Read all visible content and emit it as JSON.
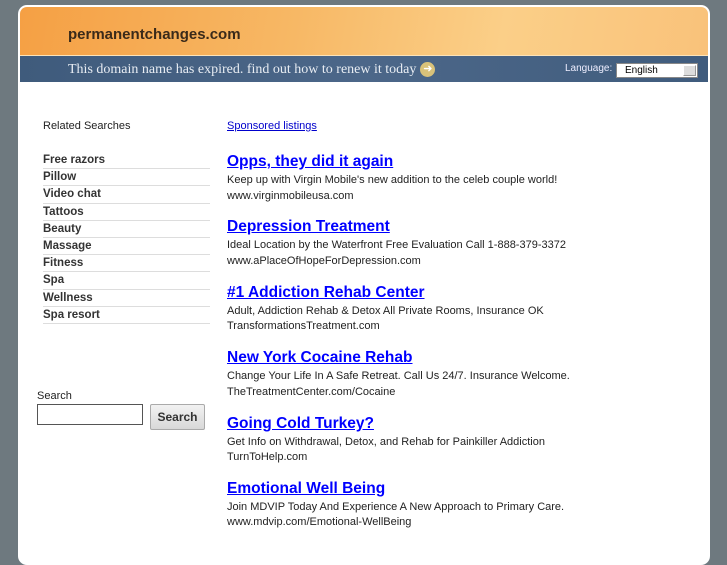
{
  "header": {
    "site": "permanentchanges.com",
    "expired": "This domain name has expired. find out how to renew it today",
    "language_label": "Language:",
    "language_value": "English"
  },
  "sidebar": {
    "title": "Related Searches",
    "items": [
      "Free razors",
      "Pillow",
      "Video chat",
      "Tattoos",
      "Beauty",
      "Massage",
      "Fitness",
      "Spa",
      "Wellness",
      "Spa resort"
    ],
    "search_label": "Search",
    "search_button": "Search",
    "search_value": ""
  },
  "main": {
    "sponsored": "Sponsored listings",
    "ads": [
      {
        "title": "Opps, they did it again",
        "desc": "Keep up with Virgin Mobile's new addition to the celeb couple world!",
        "url": "www.virginmobileusa.com"
      },
      {
        "title": "Depression Treatment",
        "desc": "Ideal Location by the Waterfront Free Evaluation Call 1-888-379-3372",
        "url": "www.aPlaceOfHopeForDepression.com"
      },
      {
        "title": "#1 Addiction Rehab Center",
        "desc": "Adult, Addiction Rehab & Detox All Private Rooms, Insurance OK",
        "url": "TransformationsTreatment.com"
      },
      {
        "title": "New York Cocaine Rehab",
        "desc": "Change Your Life In A Safe Retreat. Call Us 24/7. Insurance Welcome.",
        "url": "TheTreatmentCenter.com/Cocaine"
      },
      {
        "title": "Going Cold Turkey?",
        "desc": "Get Info on Withdrawal, Detox, and Rehab for Painkiller Addiction",
        "url": "TurnToHelp.com"
      },
      {
        "title": "Emotional Well Being",
        "desc": "Join MDVIP Today And Experience A New Approach to Primary Care.",
        "url": "www.mdvip.com/Emotional-WellBeing"
      }
    ]
  }
}
